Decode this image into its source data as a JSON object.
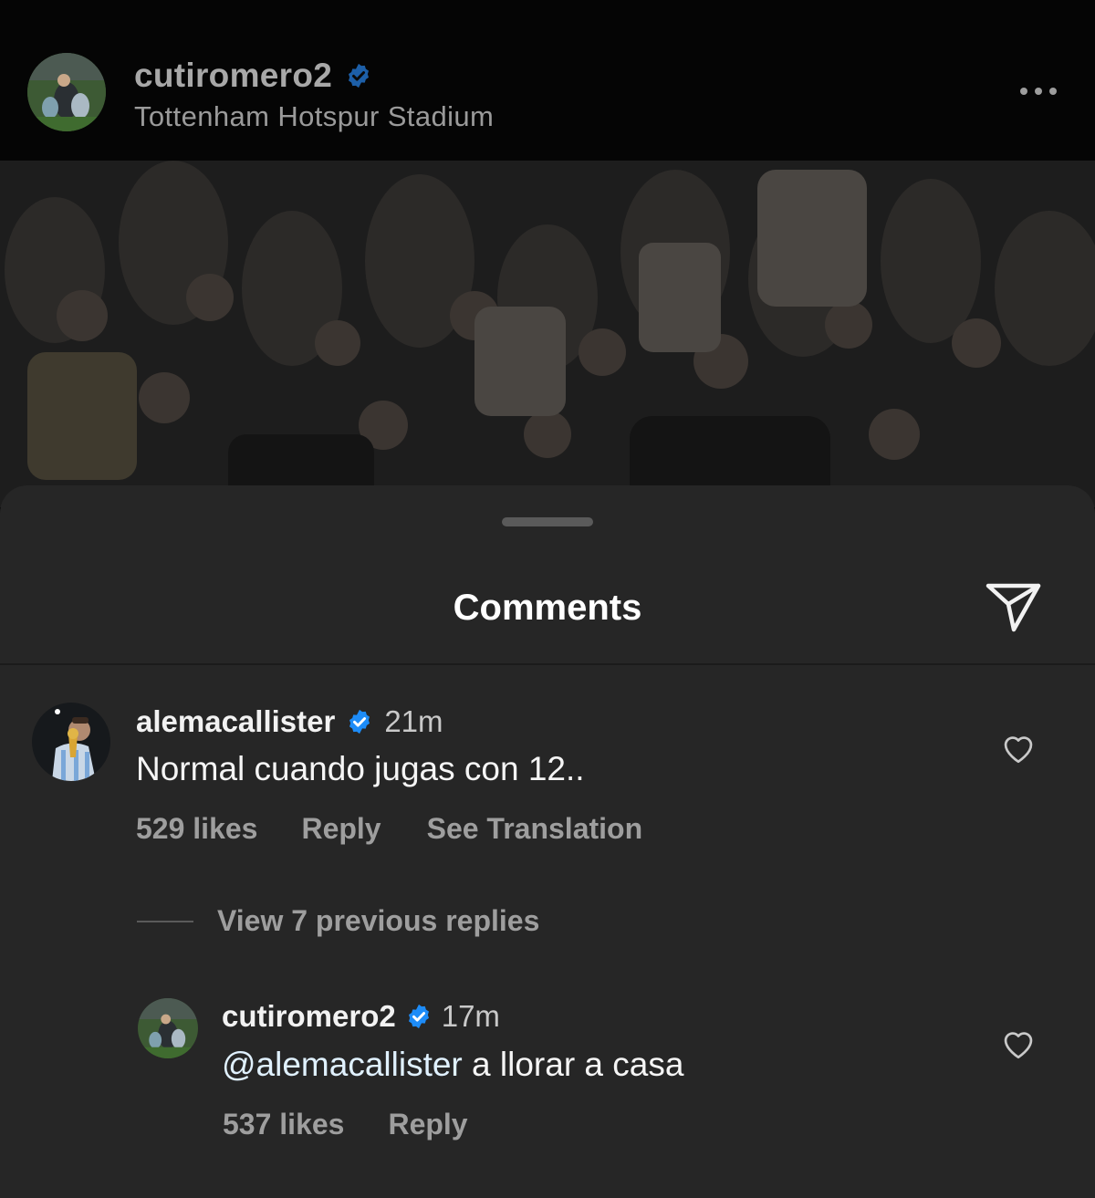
{
  "post": {
    "username": "cutiromero2",
    "location": "Tottenham Hotspur Stadium",
    "verified": true
  },
  "comments_sheet": {
    "title": "Comments",
    "icons": {
      "share": "paper-plane-icon",
      "like": "heart-icon",
      "more": "more-options-icon",
      "verified": "verified-badge-icon"
    },
    "comment": {
      "username": "alemacallister",
      "time": "21m",
      "text": "Normal cuando jugas con 12..",
      "likes": "529 likes",
      "reply_label": "Reply",
      "translation_label": "See Translation"
    },
    "view_replies_label": "View 7 previous replies",
    "reply": {
      "username": "cutiromero2",
      "time": "17m",
      "mention": "@alemacallister",
      "text": "a llorar a casa",
      "likes": "537 likes",
      "reply_label": "Reply"
    }
  },
  "colors": {
    "sheet_bg": "#262626",
    "verified_blue": "#1d8cf8",
    "muted_text": "#9e9e9e"
  }
}
